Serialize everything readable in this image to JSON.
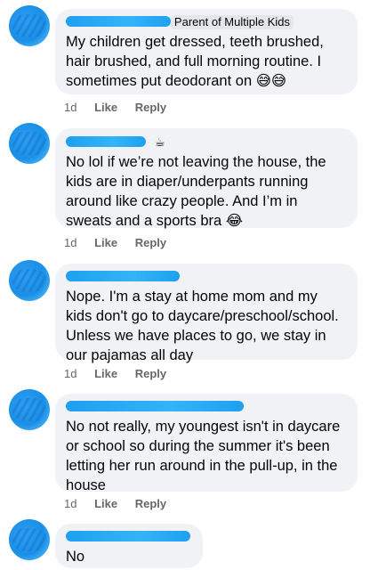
{
  "comments": [
    {
      "badge": "Parent of Multiple Kids",
      "text": "My children get dressed, teeth brushed, hair brushed, and full morning routine. I sometimes put deodorant on 😅😅",
      "time": "1d",
      "like": "Like",
      "reply": "Reply"
    },
    {
      "icon": "coffee-cup-icon",
      "text": "No lol if we’re not leaving the house, the kids are in diaper/underpants running around like crazy people. And I’m in sweats and a sports bra 😂",
      "time": "1d",
      "like": "Like",
      "reply": "Reply"
    },
    {
      "text": "Nope. I'm a stay at home mom and my kids don't go to daycare/preschool/school. Unless we have places to go, we stay in our pajamas all day",
      "time": "1d",
      "like": "Like",
      "reply": "Reply"
    },
    {
      "text": "No not really, my youngest isn't in daycare or school so during the summer it's been letting her run around in the pull-up, in the house",
      "time": "1d",
      "like": "Like",
      "reply": "Reply"
    },
    {
      "text": "No"
    }
  ]
}
